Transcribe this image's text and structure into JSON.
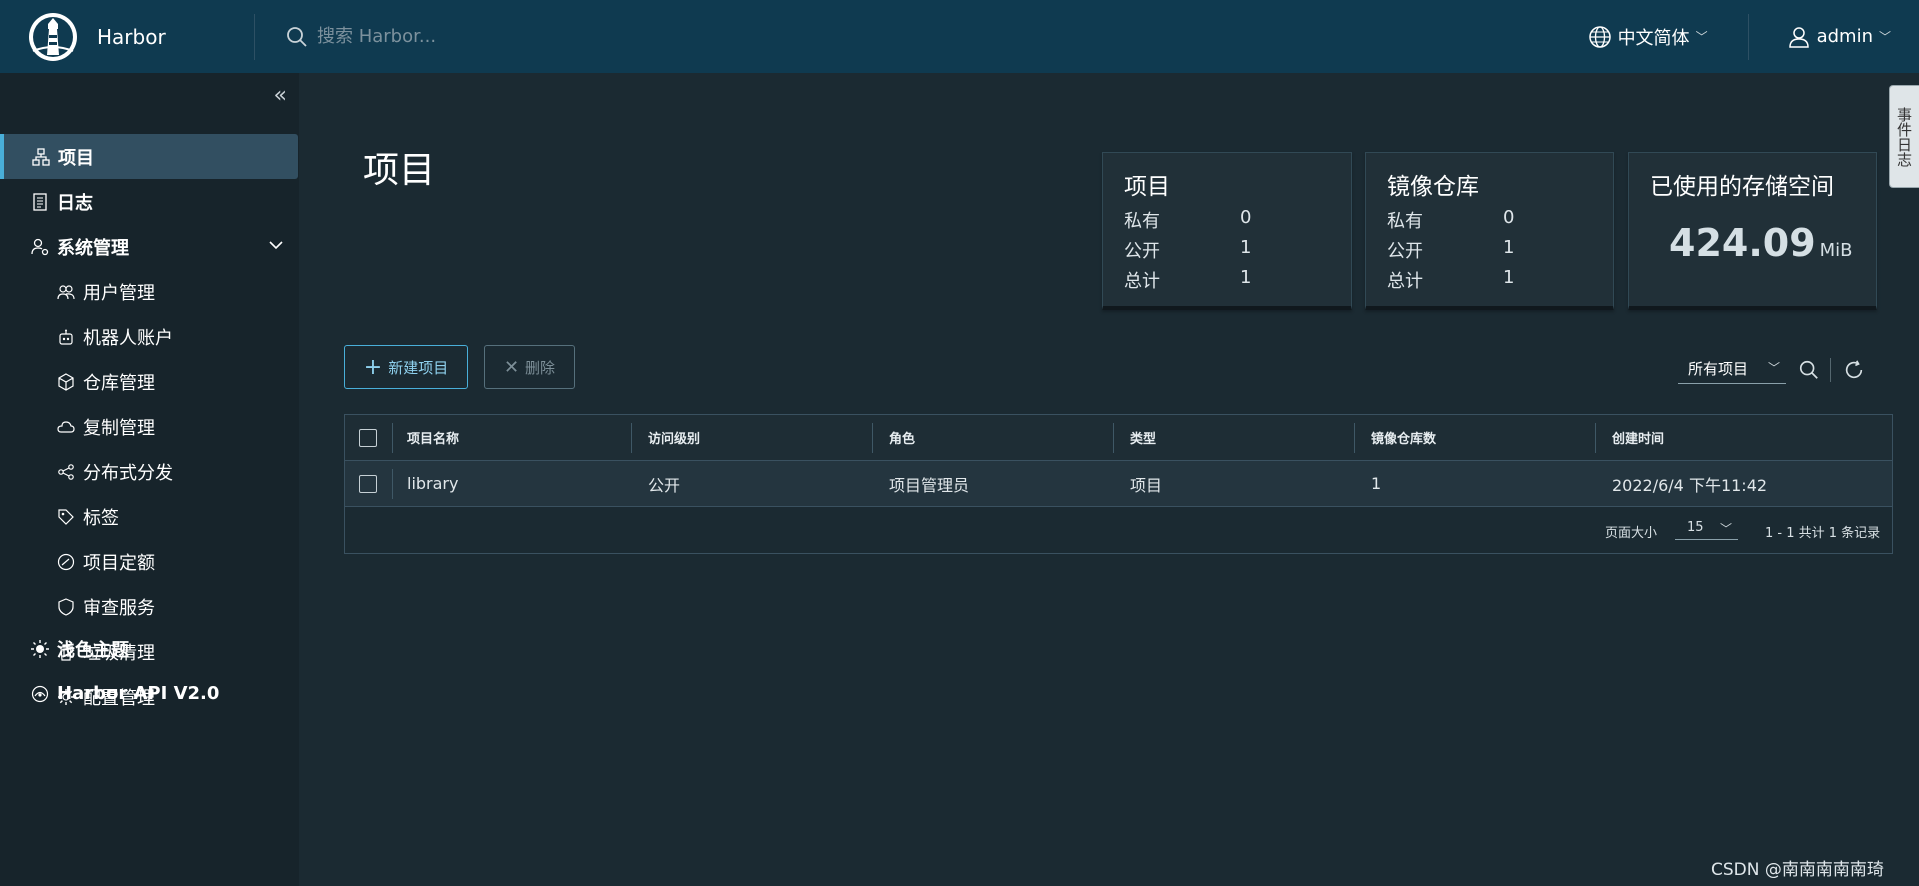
{
  "header": {
    "brand": "Harbor",
    "search_placeholder": "搜索 Harbor...",
    "language": "中文简体",
    "user": "admin"
  },
  "sidebar": {
    "items": [
      {
        "label": "项目",
        "icon": "projects-icon",
        "active": true
      },
      {
        "label": "日志",
        "icon": "logs-icon"
      },
      {
        "label": "系统管理",
        "icon": "admin-icon"
      }
    ],
    "admin_items": [
      {
        "label": "用户管理",
        "icon": "users-icon"
      },
      {
        "label": "机器人账户",
        "icon": "robot-icon"
      },
      {
        "label": "仓库管理",
        "icon": "box-icon"
      },
      {
        "label": "复制管理",
        "icon": "cloud-icon"
      },
      {
        "label": "分布式分发",
        "icon": "share-icon"
      },
      {
        "label": "标签",
        "icon": "tag-icon"
      },
      {
        "label": "项目定额",
        "icon": "dashboard-icon"
      },
      {
        "label": "审查服务",
        "icon": "shield-icon"
      },
      {
        "label": "垃圾清理",
        "icon": "trash-icon"
      },
      {
        "label": "配置管理",
        "icon": "gear-icon"
      }
    ],
    "theme": "浅色主题",
    "api": "Harbor API V2.0"
  },
  "main": {
    "title": "项目",
    "cards": {
      "projects": {
        "title": "项目",
        "private_label": "私有",
        "private": "0",
        "public_label": "公开",
        "public": "1",
        "total_label": "总计",
        "total": "1"
      },
      "repos": {
        "title": "镜像仓库",
        "private_label": "私有",
        "private": "0",
        "public_label": "公开",
        "public": "1",
        "total_label": "总计",
        "total": "1"
      },
      "storage": {
        "title": "已使用的存储空间",
        "value": "424.09",
        "unit": "MiB"
      }
    },
    "new_button": "新建项目",
    "delete_button": "删除",
    "filter": "所有项目",
    "columns": [
      "项目名称",
      "访问级别",
      "角色",
      "类型",
      "镜像仓库数",
      "创建时间"
    ],
    "rows": [
      {
        "name": "library",
        "access": "公开",
        "role": "项目管理员",
        "type": "项目",
        "repo_count": "1",
        "created": "2022/6/4 下午11:42"
      }
    ],
    "page_size_label": "页面大小",
    "page_size": "15",
    "page_count": "1 - 1 共计 1 条记录"
  },
  "side_tab": "事件日志",
  "watermark": "CSDN @南南南南南琦",
  "colors": {
    "accent": "#49afd9",
    "header": "#0f3a50",
    "sidebar": "#17242b",
    "background": "#1b2a32"
  }
}
